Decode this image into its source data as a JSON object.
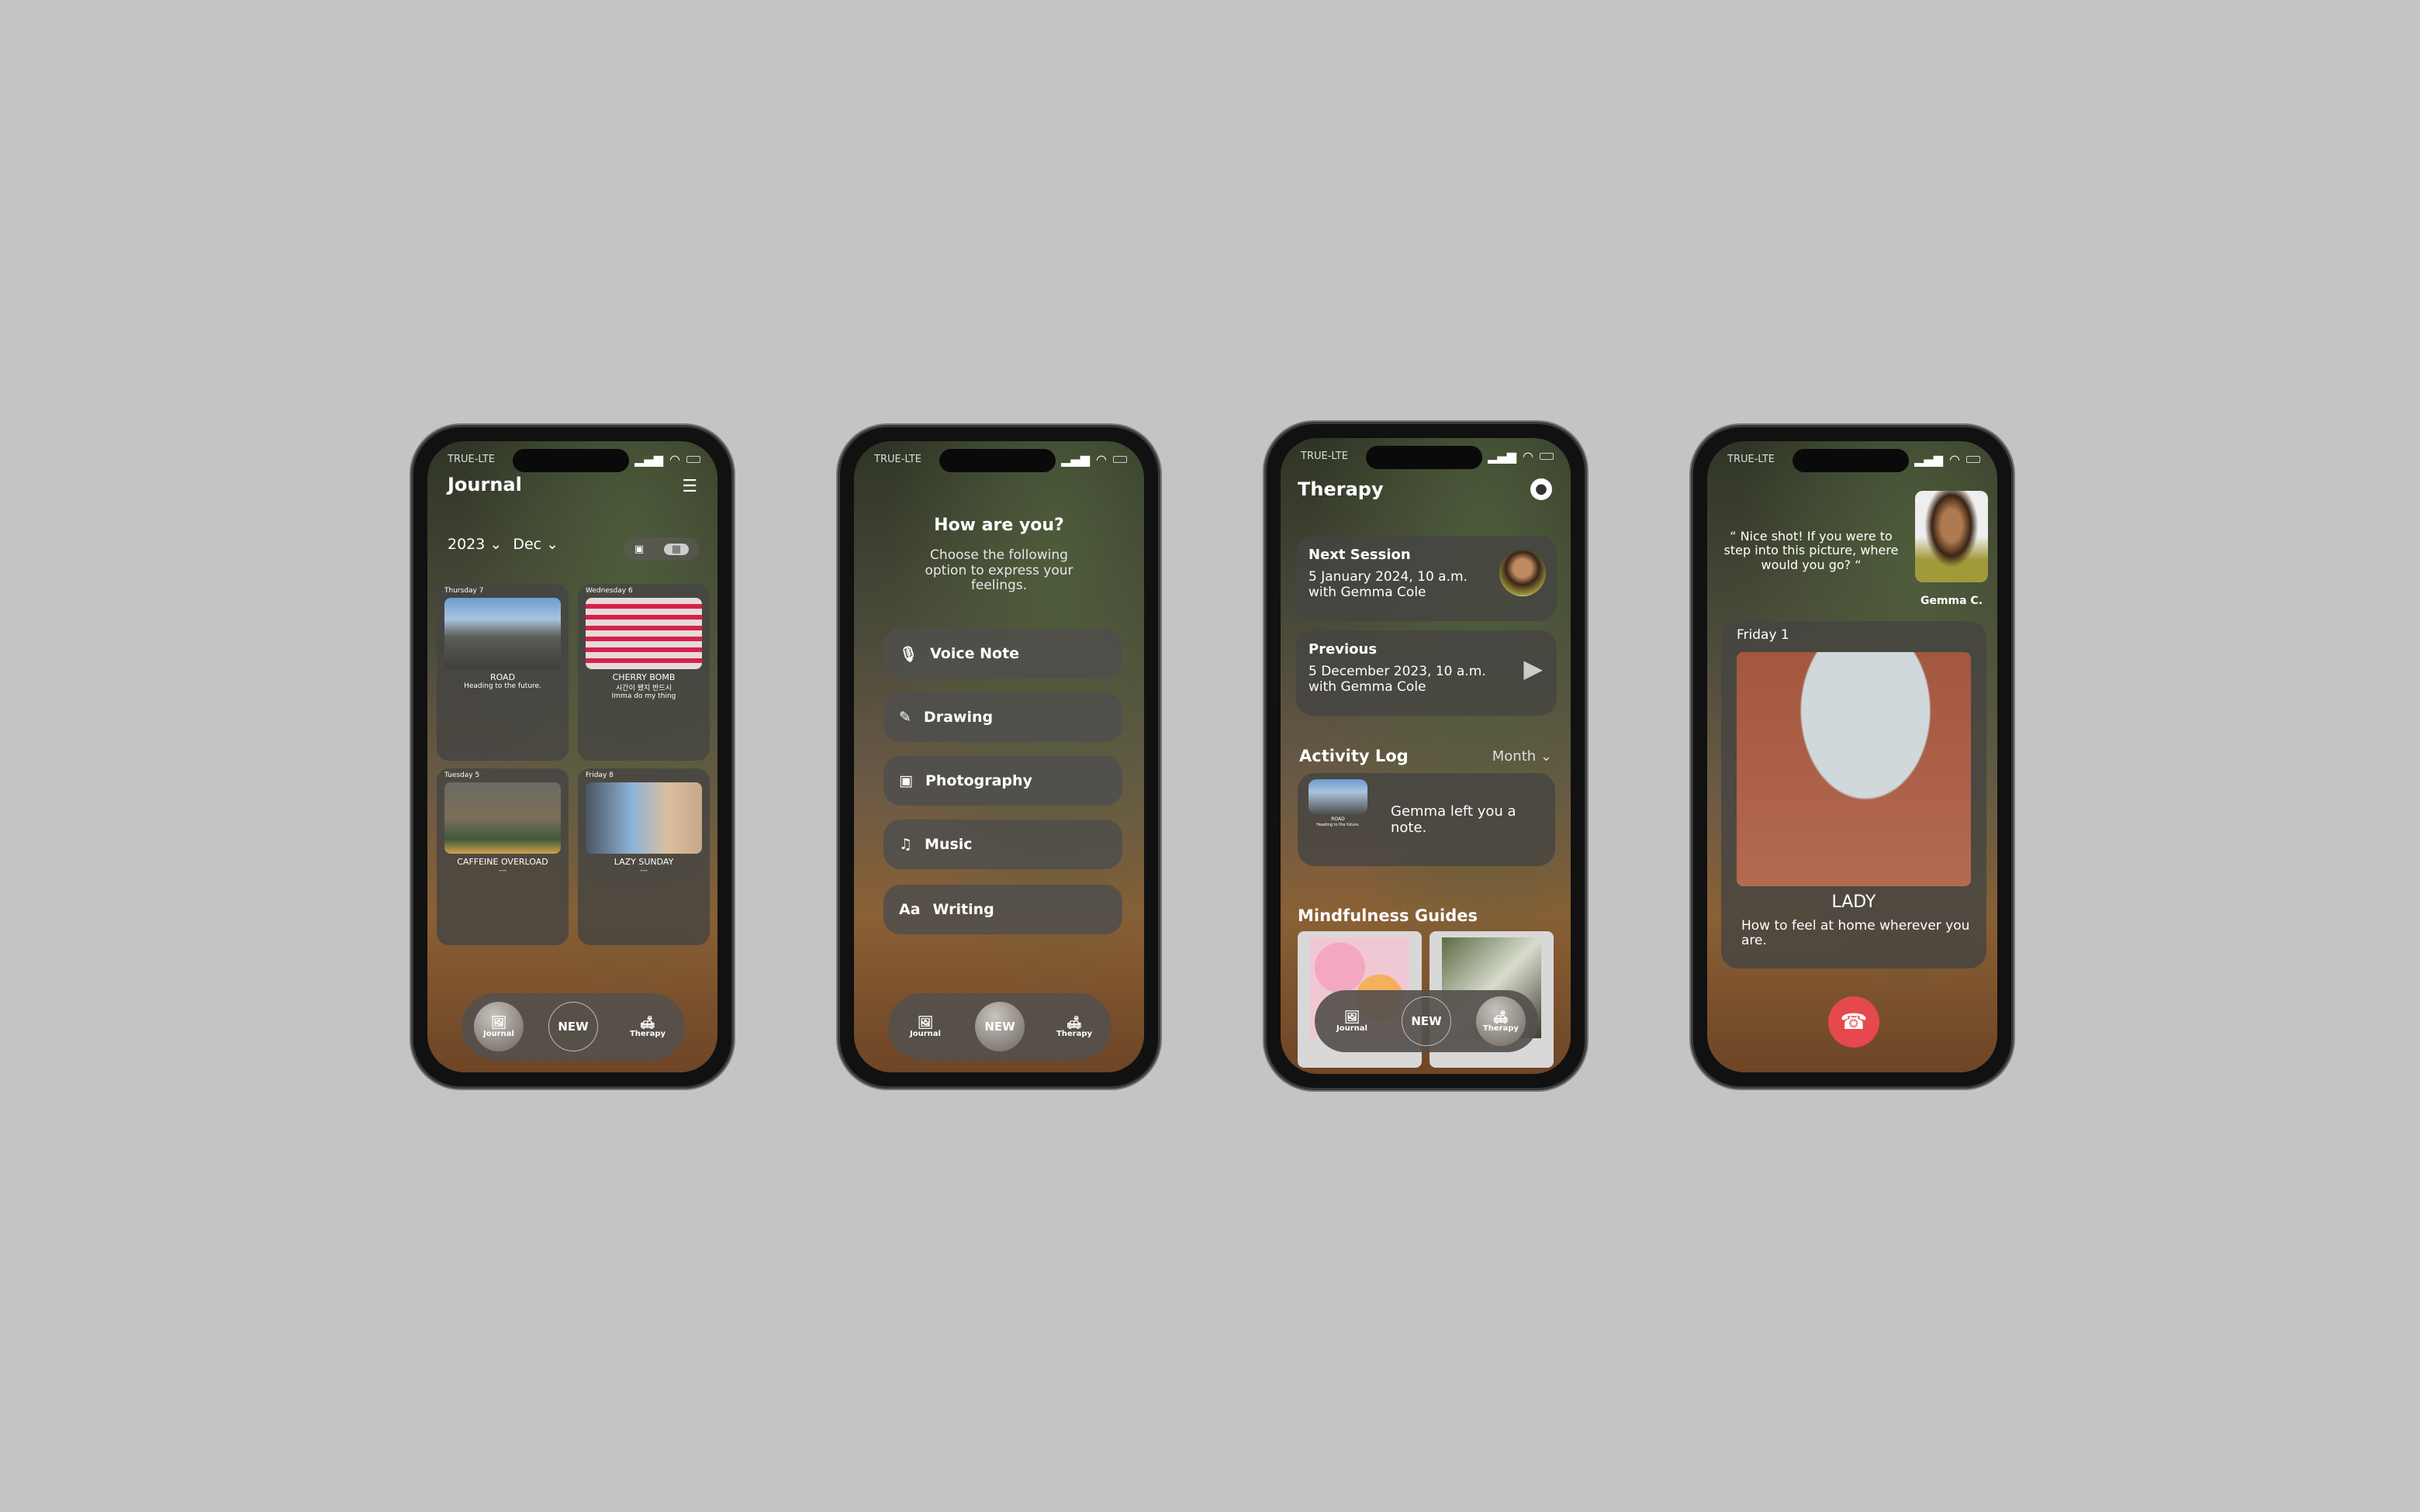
{
  "status": {
    "carrier": "TRUE-LTE"
  },
  "journal": {
    "title": "Journal",
    "year": "2023",
    "month": "Dec",
    "entries": [
      {
        "day": "Thursday 7",
        "title": "ROAD",
        "caption": "Heading to the future.",
        "caption2": ""
      },
      {
        "day": "Wednesday 6",
        "title": "CHERRY BOMB",
        "caption": "시간이 됐지 반드시",
        "caption2": "Imma do my thing"
      },
      {
        "day": "Tuesday 5",
        "title": "CAFFEINE OVERLOAD",
        "caption": "---",
        "caption2": ""
      },
      {
        "day": "Friday 8",
        "title": "LAZY SUNDAY",
        "caption": "---",
        "caption2": ""
      }
    ]
  },
  "nav": {
    "journal": "Journal",
    "new": "NEW",
    "therapy": "Therapy"
  },
  "new_entry": {
    "title": "How are you?",
    "subtitle": "Choose the following option to express your feelings.",
    "options": [
      {
        "label": "Voice Note",
        "icon": "microphone-icon"
      },
      {
        "label": "Drawing",
        "icon": "pen-icon"
      },
      {
        "label": "Photography",
        "icon": "image-icon"
      },
      {
        "label": "Music",
        "icon": "music-note-icon"
      },
      {
        "label": "Writing",
        "icon": "text-icon"
      }
    ]
  },
  "therapy": {
    "title": "Therapy",
    "next": {
      "label": "Next Session",
      "date": "5 January 2024, 10 a.m.",
      "with": "with Gemma Cole"
    },
    "previous": {
      "label": "Previous",
      "date": "5 December 2023, 10 a.m.",
      "with": "with Gemma Cole"
    },
    "activity_title": "Activity Log",
    "activity_filter": "Month",
    "activity_note": "Gemma left you a note.",
    "note_thumb_title": "ROAD",
    "note_thumb_caption": "Heading to the future.",
    "guides_title": "Mindfulness Guides"
  },
  "call": {
    "quote": "“ Nice shot! If you were to step into this picture, where would you go? “",
    "caller": "Gemma C.",
    "entry": {
      "day": "Friday 1",
      "title": "LADY",
      "caption": "How to feel at home wherever you are."
    }
  },
  "colors": {
    "background": "#c4c4c4",
    "end_call": "#e5484d"
  }
}
